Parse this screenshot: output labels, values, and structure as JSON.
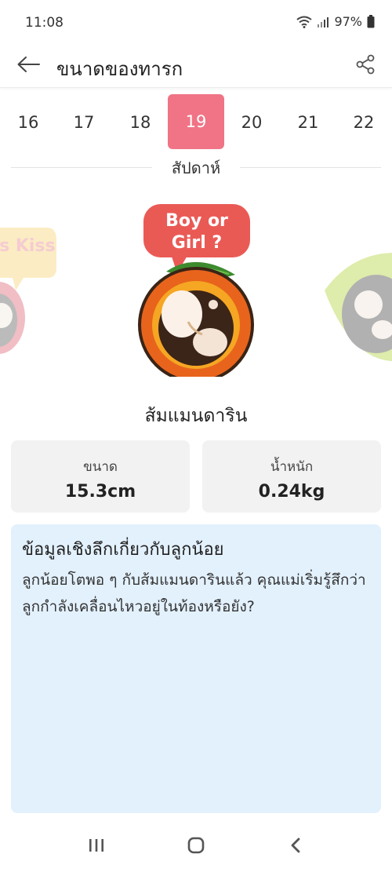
{
  "status": {
    "time": "11:08",
    "battery": "97%"
  },
  "header": {
    "title": "ขนาดของทารก"
  },
  "weeks": {
    "items": [
      "16",
      "17",
      "18",
      "19",
      "20",
      "21",
      "22"
    ],
    "selected": "19",
    "caption": "สัปดาห์"
  },
  "carousel": {
    "left_bubble": "Kiss Kiss",
    "center_bubble_line1": "Boy or",
    "center_bubble_line2": "Girl ?"
  },
  "fruit": {
    "name": "ส้มแมนดาริน"
  },
  "stats": {
    "size_label": "ขนาด",
    "size_value": "15.3cm",
    "weight_label": "น้ำหนัก",
    "weight_value": "0.24kg"
  },
  "insight": {
    "title": "ข้อมูลเชิงลึกเกี่ยวกับลูกน้อย",
    "body": "ลูกน้อยโตพอ ๆ กับส้มแมนดารินแล้ว คุณแม่เริ่มรู้สึกว่าลูกกำลังเคลื่อนไหวอยู่ในท้องหรือยัง?"
  },
  "colors": {
    "accent": "#f07486",
    "card": "#f2f2f2",
    "insight_bg": "#e3f1fd"
  },
  "icons": {
    "back": "arrow-left-icon",
    "share": "share-icon",
    "recents": "recents-icon",
    "home": "home-icon",
    "nav_back": "chevron-left-icon"
  }
}
